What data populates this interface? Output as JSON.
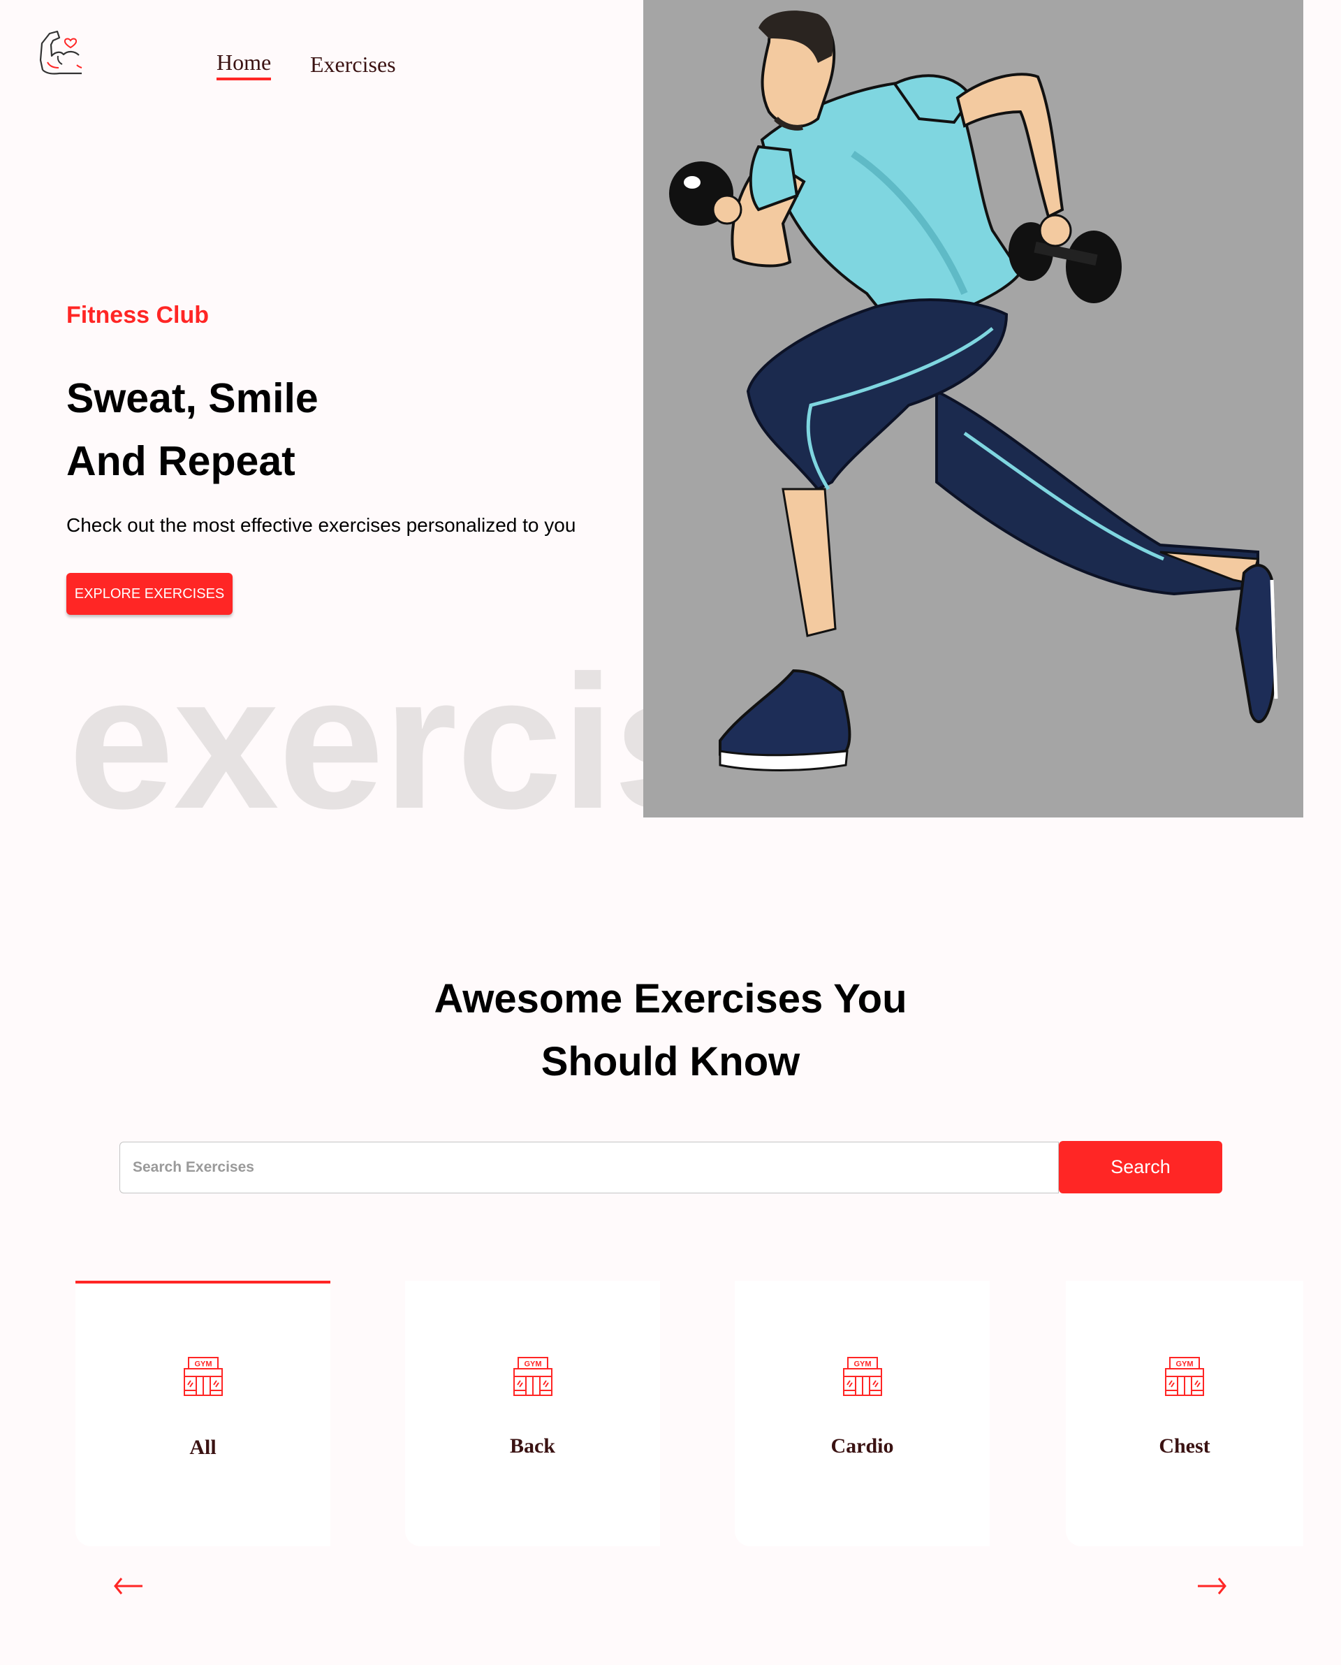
{
  "navbar": {
    "logo_icon": "flexed-bicep-heart-icon",
    "links": [
      {
        "label": "Home",
        "active": true
      },
      {
        "label": "Exercises",
        "active": false
      }
    ]
  },
  "hero": {
    "tagline": "Fitness Club",
    "title_line1": "Sweat, Smile",
    "title_line2": "And Repeat",
    "subtitle": "Check out the most effective exercises personalized to you",
    "cta_label": "EXPLORE EXERCISES",
    "watermark": "exercises",
    "image_alt": "Man running with dumbbells illustration"
  },
  "search_section": {
    "title_line1": "Awesome Exercises You",
    "title_line2": "Should Know",
    "input_placeholder": "Search Exercises",
    "input_value": "",
    "search_label": "Search"
  },
  "body_parts": {
    "items": [
      {
        "label": "All",
        "icon": "gym-icon",
        "selected": true
      },
      {
        "label": "Back",
        "icon": "gym-icon",
        "selected": false
      },
      {
        "label": "Cardio",
        "icon": "gym-icon",
        "selected": false
      },
      {
        "label": "Chest",
        "icon": "gym-icon",
        "selected": false
      }
    ],
    "prev_icon": "arrow-left-icon",
    "next_icon": "arrow-right-icon"
  },
  "colors": {
    "accent": "#ff2625",
    "background": "#fffafb",
    "text_dark": "#3a1212",
    "watermark": "#e6e2e2"
  }
}
